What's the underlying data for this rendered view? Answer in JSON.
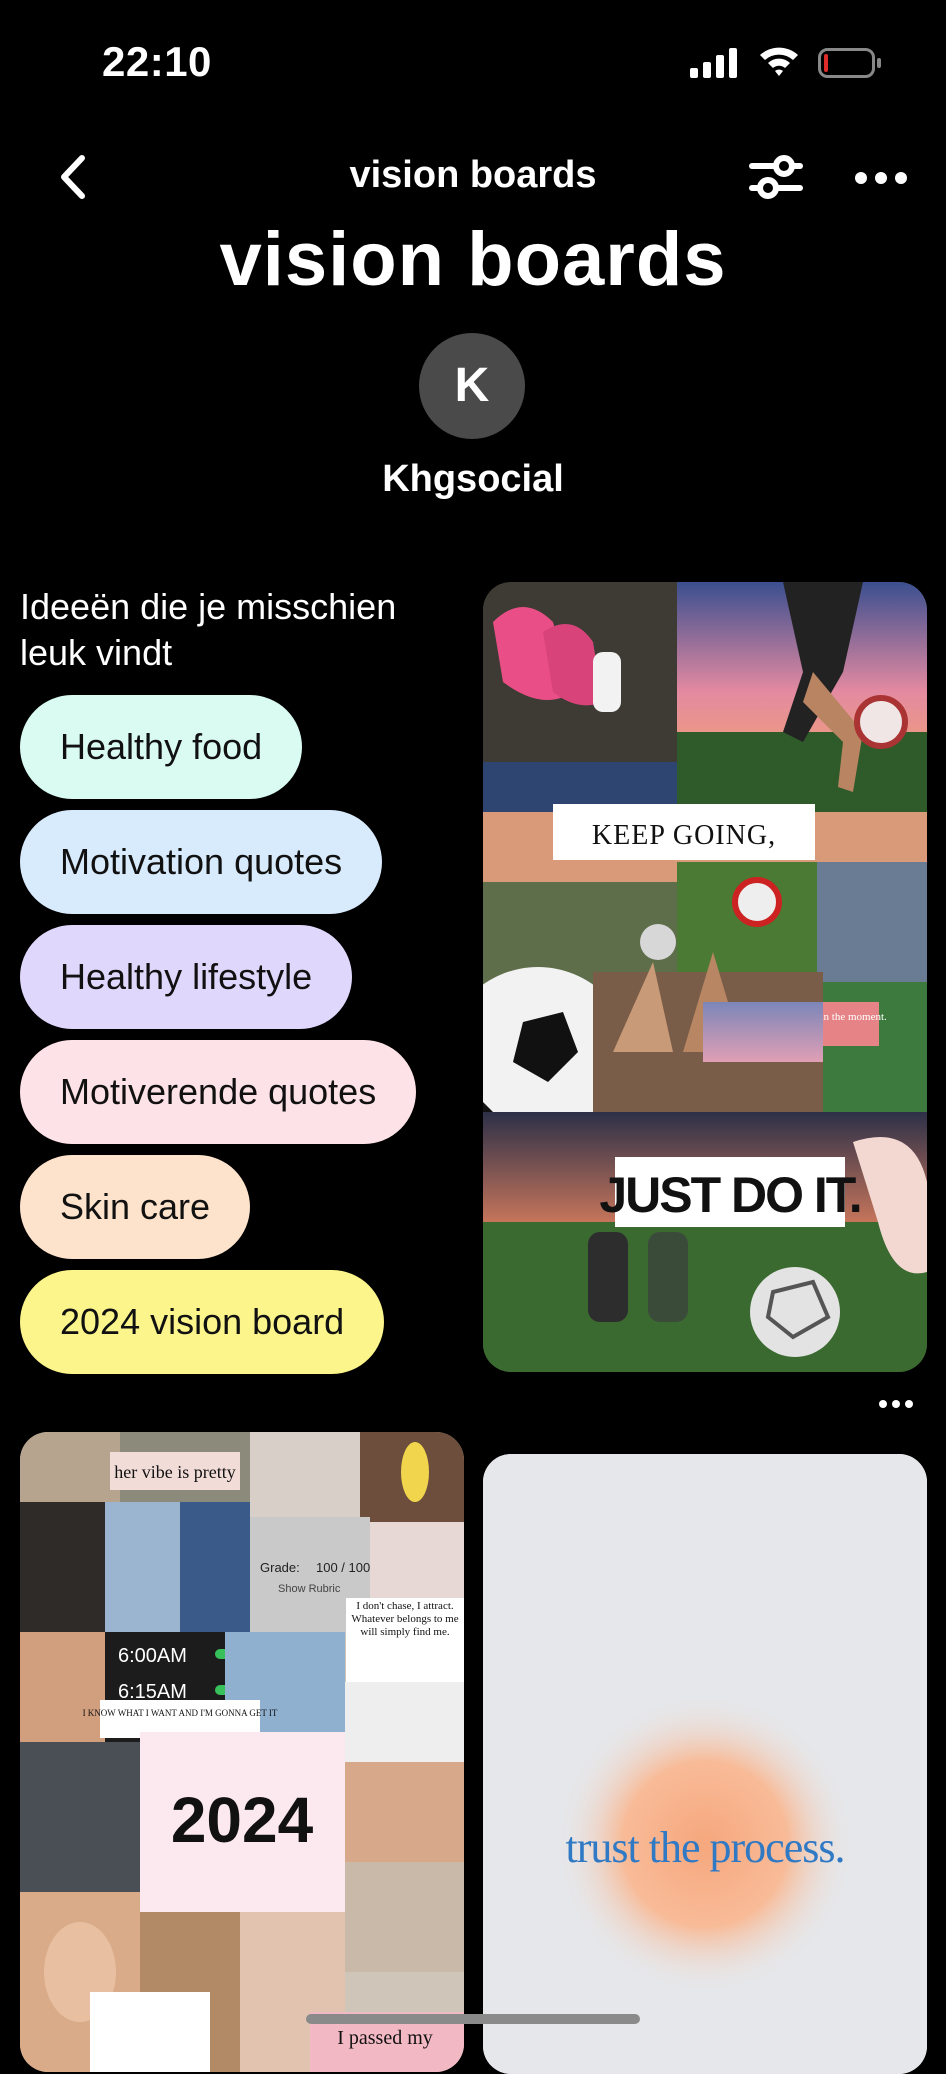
{
  "status_bar": {
    "time": "22:10"
  },
  "nav": {
    "title": "vision boards"
  },
  "board": {
    "title": "vision boards",
    "avatar_letter": "K",
    "owner": "Khgsocial"
  },
  "ideas": {
    "heading": "Ideeën die je misschien leuk vindt",
    "chips": [
      {
        "label": "Healthy food",
        "color": "#d9fbf2"
      },
      {
        "label": "Motivation quotes",
        "color": "#d8ebfd"
      },
      {
        "label": "Healthy lifestyle",
        "color": "#e0d7fc"
      },
      {
        "label": "Motiverende quotes",
        "color": "#fde2e7"
      },
      {
        "label": "Skin care",
        "color": "#fde3cb"
      },
      {
        "label": "2024 vision board",
        "color": "#fbf58b"
      }
    ]
  },
  "pins": {
    "pin1": {
      "keep_going": "KEEP GOING,",
      "just_do_it": "JUST DO IT.",
      "live": "live in the moment."
    },
    "pin2": {
      "her_vibe": "her vibe is pretty",
      "grade_label": "Grade:",
      "grade_value": "100 / 100",
      "rubric": "Show Rubric",
      "chase": "I don't chase, I attract. Whatever belongs to me will simply find me.",
      "alarm1": "6:00AM",
      "alarm2": "6:15AM",
      "know": "I KNOW WHAT I WANT AND I'M GONNA GET IT",
      "year": "2024",
      "passed": "I passed my"
    },
    "pin3": {
      "text": "trust the process."
    }
  },
  "colors": {
    "accent_blue": "#2f79c5"
  }
}
